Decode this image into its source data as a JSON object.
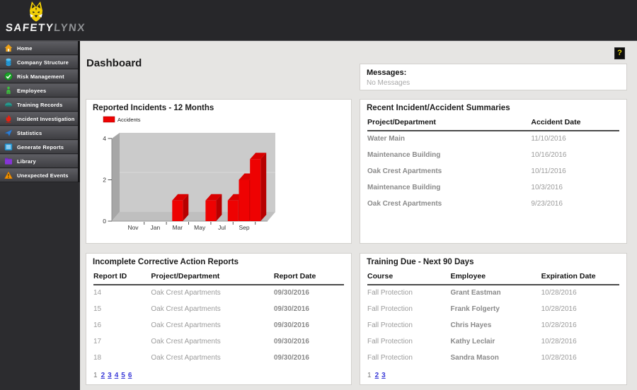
{
  "app": {
    "brand_primary": "SAFETY",
    "brand_secondary": "LYNX"
  },
  "page": {
    "title": "Dashboard",
    "help_label": "?"
  },
  "messages": {
    "title": "Messages:",
    "empty_text": "No Messages"
  },
  "sidebar": {
    "items": [
      {
        "label": "Home",
        "icon": "home-icon"
      },
      {
        "label": "Company Structure",
        "icon": "company-structure-icon"
      },
      {
        "label": "Risk Management",
        "icon": "risk-management-icon"
      },
      {
        "label": "Employees",
        "icon": "employees-icon"
      },
      {
        "label": "Training Records",
        "icon": "training-records-icon"
      },
      {
        "label": "Incident Investigation",
        "icon": "incident-investigation-icon"
      },
      {
        "label": "Statistics",
        "icon": "statistics-icon"
      },
      {
        "label": "Generate Reports",
        "icon": "generate-reports-icon"
      },
      {
        "label": "Library",
        "icon": "library-icon"
      },
      {
        "label": "Unexpected Events",
        "icon": "unexpected-events-icon"
      }
    ]
  },
  "chart_data": {
    "type": "bar",
    "style": "3d",
    "title": "Reported Incidents - 12 Months",
    "legend": [
      {
        "name": "Accidents",
        "color": "#ee0202"
      }
    ],
    "categories": [
      "Nov",
      "Dec",
      "Jan",
      "Feb",
      "Mar",
      "Apr",
      "May",
      "Jun",
      "Jul",
      "Aug",
      "Sep",
      "Oct"
    ],
    "values": [
      0,
      0,
      0,
      0,
      1,
      0,
      0,
      1,
      0,
      1,
      2,
      3
    ],
    "x_tick_labels": [
      "Nov",
      "Jan",
      "Mar",
      "May",
      "Jul",
      "Sep"
    ],
    "y_ticks": [
      0,
      2,
      4
    ],
    "ylim": [
      0,
      4
    ],
    "grid": true,
    "legend_position": "top-left"
  },
  "panels": {
    "recent": {
      "title": "Recent Incident/Accident Summaries",
      "columns": [
        "Project/Department",
        "Accident Date"
      ],
      "rows": [
        [
          "Water Main",
          "11/10/2016"
        ],
        [
          "Maintenance Building",
          "10/16/2016"
        ],
        [
          "Oak Crest Apartments",
          "10/11/2016"
        ],
        [
          "Maintenance Building",
          "10/3/2016"
        ],
        [
          "Oak Crest Apartments",
          "9/23/2016"
        ]
      ]
    },
    "incomplete": {
      "title": "Incomplete Corrective Action Reports",
      "columns": [
        "Report ID",
        "Project/Department",
        "Report Date"
      ],
      "rows": [
        [
          "14",
          "Oak Crest Apartments",
          "09/30/2016"
        ],
        [
          "15",
          "Oak Crest Apartments",
          "09/30/2016"
        ],
        [
          "16",
          "Oak Crest Apartments",
          "09/30/2016"
        ],
        [
          "17",
          "Oak Crest Apartments",
          "09/30/2016"
        ],
        [
          "18",
          "Oak Crest Apartments",
          "09/30/2016"
        ]
      ],
      "pagination": {
        "current": "1",
        "links": [
          "2",
          "3",
          "4",
          "5",
          "6"
        ]
      }
    },
    "training": {
      "title": "Training Due - Next 90 Days",
      "columns": [
        "Course",
        "Employee",
        "Expiration Date"
      ],
      "rows": [
        [
          "Fall Protection",
          "Grant Eastman",
          "10/28/2016"
        ],
        [
          "Fall Protection",
          "Frank Folgerty",
          "10/28/2016"
        ],
        [
          "Fall Protection",
          "Chris Hayes",
          "10/28/2016"
        ],
        [
          "Fall Protection",
          "Kathy Leclair",
          "10/28/2016"
        ],
        [
          "Fall Protection",
          "Sandra Mason",
          "10/28/2016"
        ]
      ],
      "pagination": {
        "current": "1",
        "links": [
          "2",
          "3"
        ]
      }
    }
  },
  "colors": {
    "accent_red": "#ee0202",
    "link_blue": "#3b3bd8",
    "brand_yellow": "#f2cf05",
    "header_dark": "#27272a",
    "sidebar_dark": "#2c2c2f",
    "content_bg": "#e6e5e3"
  }
}
